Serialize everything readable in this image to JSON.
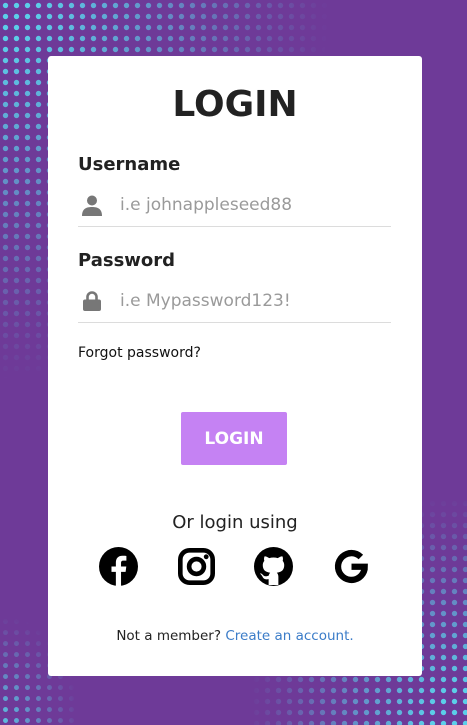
{
  "login_form": {
    "title": "LOGIN",
    "username": {
      "label": "Username",
      "value": "",
      "placeholder": "i.e johnappleseed88",
      "icon": "user-icon"
    },
    "password": {
      "label": "Password",
      "value": "",
      "placeholder": "i.e Mypassword123!",
      "icon": "lock-icon"
    },
    "forgot_password_link": "Forgot password?",
    "login_button": "LOGIN",
    "alt_login_text": "Or login using",
    "social_providers": [
      {
        "name": "facebook",
        "icon": "facebook-icon"
      },
      {
        "name": "instagram",
        "icon": "instagram-icon"
      },
      {
        "name": "github",
        "icon": "github-icon"
      },
      {
        "name": "google",
        "icon": "google-icon"
      }
    ],
    "signup_prompt": "Not a member?",
    "signup_link": "Create an account."
  },
  "colors": {
    "background": "#6e3a98",
    "dot_accent": "#5bd8ee",
    "button": "#c582f3",
    "link": "#3b7cc8",
    "card": "#ffffff"
  }
}
